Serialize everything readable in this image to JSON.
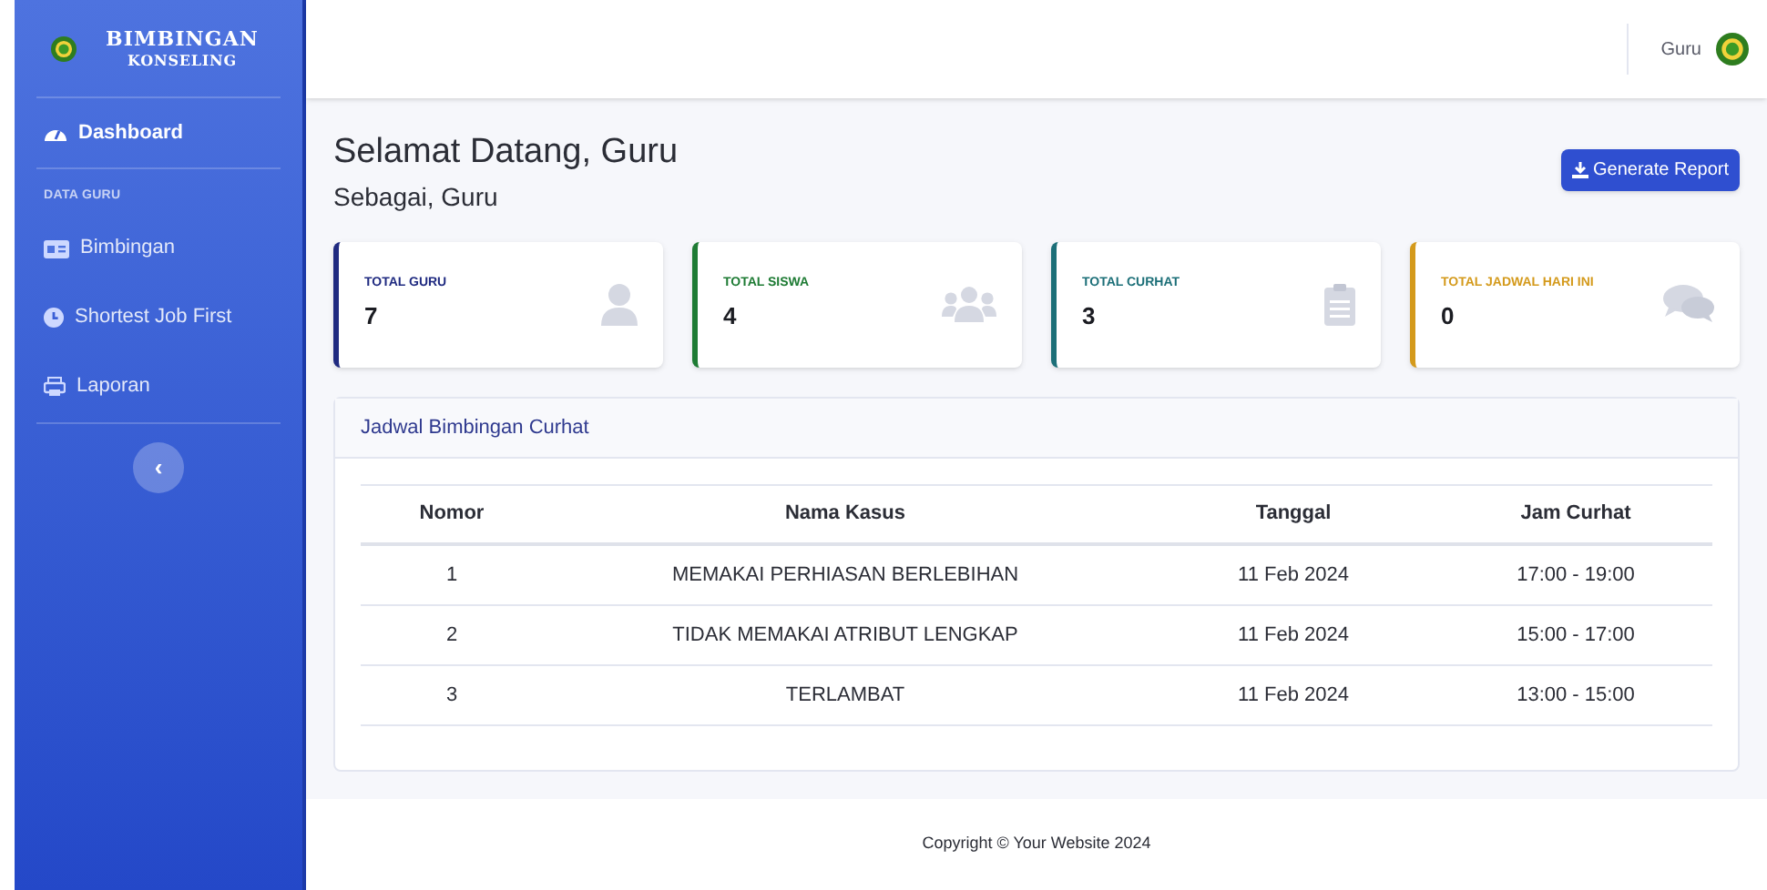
{
  "sidebar": {
    "brand": [
      "BIMBINGAN",
      "KONSELING"
    ],
    "items": [
      {
        "kind": "link",
        "label": "Dashboard",
        "selected": true
      },
      {
        "kind": "heading",
        "label": "DATA GURU"
      },
      {
        "kind": "link",
        "label": "Bimbingan",
        "selected": false
      },
      {
        "kind": "link",
        "label": "Shortest Job First",
        "selected": false
      },
      {
        "kind": "link",
        "label": "Laporan",
        "selected": false
      }
    ],
    "toggle": "‹"
  },
  "topbar": {
    "user": "Guru"
  },
  "header": {
    "title": "Selamat Datang, Guru",
    "subtitle": "Sebagai, Guru",
    "button": "Generate Report"
  },
  "cards": [
    {
      "label": "TOTAL GURU",
      "value": "7",
      "color": "#1f2a80"
    },
    {
      "label": "TOTAL SISWA",
      "value": "4",
      "color": "#1e7b34"
    },
    {
      "label": "TOTAL CURHAT",
      "value": "3",
      "color": "#1c6f78"
    },
    {
      "label": "TOTAL JADWAL HARI INI",
      "value": "0",
      "color": "#d49a1c"
    }
  ],
  "table": {
    "title": "Jadwal Bimbingan Curhat",
    "columns": [
      "Nomor",
      "Nama Kasus",
      "Tanggal",
      "Jam Curhat"
    ],
    "rows": [
      [
        "1",
        "MEMAKAI PERHIASAN BERLEBIHAN",
        "11 Feb 2024",
        "17:00 - 19:00"
      ],
      [
        "2",
        "TIDAK MEMAKAI ATRIBUT LENGKAP",
        "11 Feb 2024",
        "15:00 - 17:00"
      ],
      [
        "3",
        "TERLAMBAT",
        "11 Feb 2024",
        "13:00 - 15:00"
      ]
    ]
  },
  "footer": "Copyright © Your Website 2024"
}
